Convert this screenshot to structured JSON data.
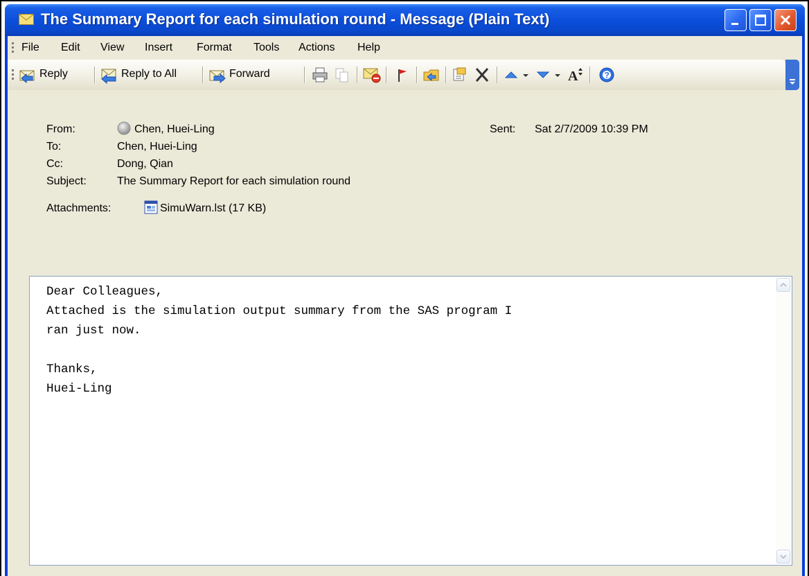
{
  "window": {
    "title": "The Summary Report for each simulation round - Message (Plain Text)",
    "controls": [
      "minimize",
      "maximize",
      "close"
    ]
  },
  "menu": [
    "File",
    "Edit",
    "View",
    "Insert",
    "Format",
    "Tools",
    "Actions",
    "Help"
  ],
  "toolbar": {
    "reply_label": "Reply",
    "reply_all_label": "Reply to All",
    "forward_label": "Forward",
    "icons": [
      "print-icon",
      "copy-icon",
      "junk-mail-icon",
      "flag-icon",
      "move-to-folder-icon",
      "categorize-icon",
      "delete-icon",
      "previous-item-icon",
      "next-item-icon",
      "font-size-icon",
      "help-icon"
    ]
  },
  "header": {
    "from_label": "From:",
    "from_value": "Chen, Huei-Ling",
    "sent_label": "Sent:",
    "sent_value": "Sat 2/7/2009 10:39 PM",
    "to_label": "To:",
    "to_value": "Chen, Huei-Ling",
    "cc_label": "Cc:",
    "cc_value": "Dong, Qian",
    "subject_label": "Subject:",
    "subject_value": "The Summary Report for each simulation round",
    "attachments_label": "Attachments:",
    "attachment_name": "SimuWarn.lst (17 KB)"
  },
  "body": {
    "text": "Dear Colleagues,\nAttached is the simulation output summary from the SAS program I\nran just now.\n\nThanks,\nHuei-Ling"
  },
  "colors": {
    "titlebar": "#0b4fdc",
    "client": "#ebe9d8",
    "close_button": "#e35a2f"
  }
}
